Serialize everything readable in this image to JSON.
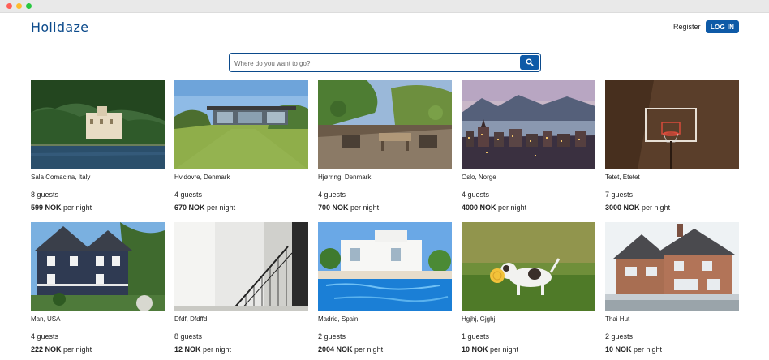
{
  "brand": {
    "name": "Holidaze",
    "primary_color": "#0b4a8b",
    "button_color": "#0e5aa7"
  },
  "window": {
    "traffic_lights": [
      "#ff5f57",
      "#febc2e",
      "#28c840"
    ]
  },
  "nav": {
    "register_label": "Register",
    "login_label": "LOG IN"
  },
  "search": {
    "placeholder": "Where do you want to go?",
    "value": "",
    "button_icon": "search-icon"
  },
  "listings": [
    {
      "location": "Sala Comacina, Italy",
      "guests": "8 guests",
      "price": "599 NOK",
      "price_suffix": "per night",
      "image": "lake-villa"
    },
    {
      "location": "Hvidovre, Denmark",
      "guests": "4 guests",
      "price": "670 NOK",
      "price_suffix": "per night",
      "image": "modern-house-lawn"
    },
    {
      "location": "Hjørring, Denmark",
      "guests": "4 guests",
      "price": "700 NOK",
      "price_suffix": "per night",
      "image": "garden-patio"
    },
    {
      "location": "Oslo, Norge",
      "guests": "4 guests",
      "price": "4000 NOK",
      "price_suffix": "per night",
      "image": "city-mountains"
    },
    {
      "location": "Tetet, Etetet",
      "guests": "7 guests",
      "price": "3000 NOK",
      "price_suffix": "per night",
      "image": "basketball-hoop"
    },
    {
      "location": "Man, USA",
      "guests": "4 guests",
      "price": "222 NOK",
      "price_suffix": "per night",
      "image": "blue-house"
    },
    {
      "location": "Dfdf, Dfdffd",
      "guests": "8 guests",
      "price": "12 NOK",
      "price_suffix": "per night",
      "image": "white-staircase"
    },
    {
      "location": "Madrid, Spain",
      "guests": "2 guests",
      "price": "2004 NOK",
      "price_suffix": "per night",
      "image": "pool-villa"
    },
    {
      "location": "Hgjhj, Gjghj",
      "guests": "1 guests",
      "price": "10 NOK",
      "price_suffix": "per night",
      "image": "dog-frisbee"
    },
    {
      "location": "Thai Hut",
      "guests": "2 guests",
      "price": "10 NOK",
      "price_suffix": "per night",
      "image": "brick-house"
    }
  ]
}
